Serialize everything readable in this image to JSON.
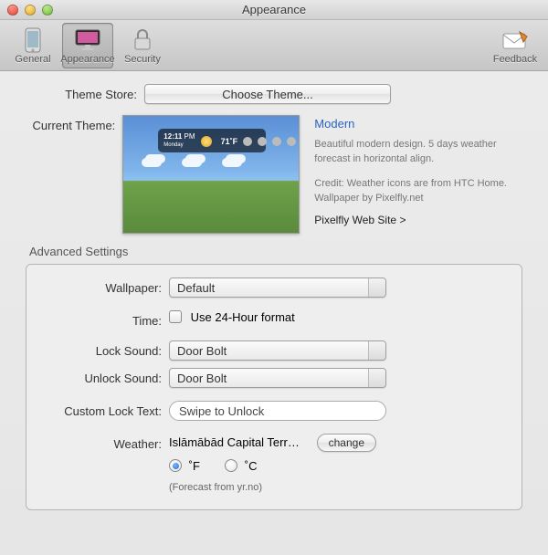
{
  "window": {
    "title": "Appearance"
  },
  "toolbar": {
    "general": "General",
    "appearance": "Appearance",
    "security": "Security",
    "feedback": "Feedback"
  },
  "themeStore": {
    "label": "Theme Store:",
    "button": "Choose Theme..."
  },
  "currentTheme": {
    "label": "Current Theme:",
    "name": "Modern",
    "desc": "Beautiful modern design. 5 days weather forecast in horizontal align.",
    "credit": "Credit: Weather icons are from HTC Home.",
    "wallpaper": "Wallpaper by Pixelfly.net",
    "link": "Pixelfly Web Site >"
  },
  "advanced": {
    "title": "Advanced Settings",
    "wallpaper": {
      "label": "Wallpaper:",
      "value": "Default"
    },
    "time": {
      "label": "Time:",
      "option": "Use 24-Hour format"
    },
    "lockSound": {
      "label": "Lock Sound:",
      "value": "Door Bolt"
    },
    "unlockSound": {
      "label": "Unlock Sound:",
      "value": "Door Bolt"
    },
    "customLock": {
      "label": "Custom Lock Text:",
      "value": "Swipe to Unlock"
    },
    "weather": {
      "label": "Weather:",
      "location": "Islāmābād Capital Terr…",
      "change": "change",
      "unitF": "˚F",
      "unitC": "˚C",
      "note": "(Forecast from yr.no)"
    }
  }
}
